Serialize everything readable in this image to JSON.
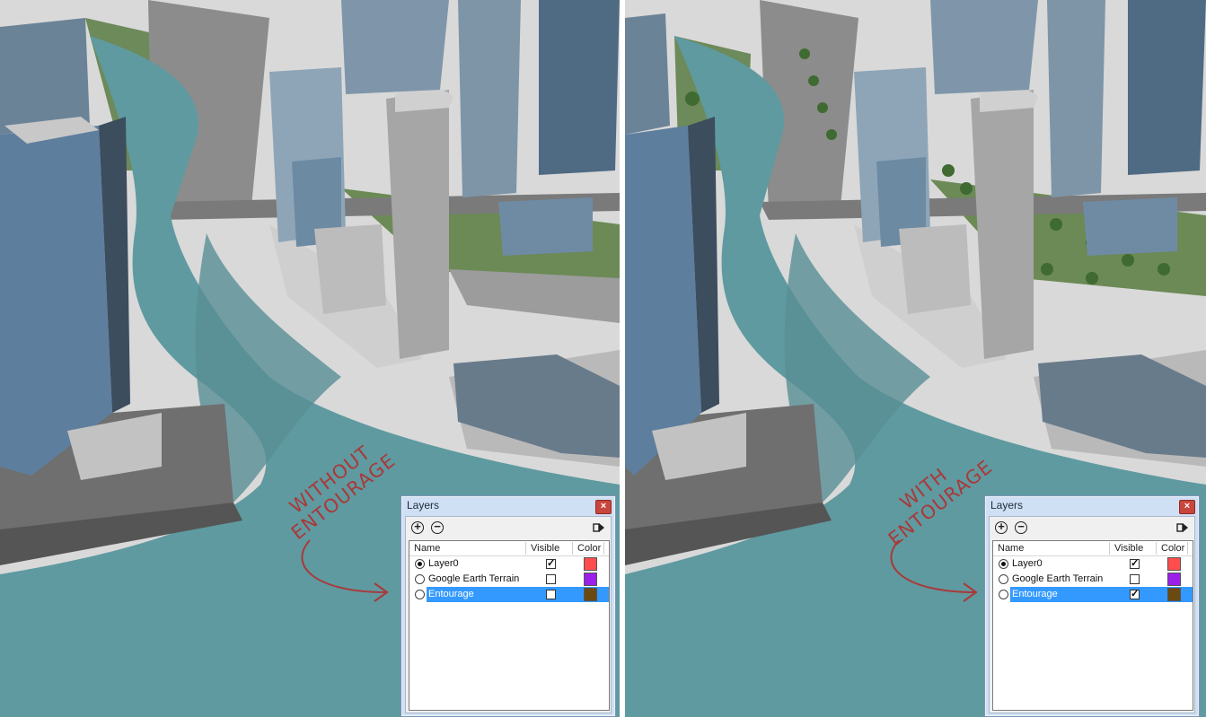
{
  "colors": {
    "water": "#5f9aa0",
    "selection": "#3399ff",
    "annotation": "#a83a3a"
  },
  "left": {
    "annotation": [
      "WITHOUT",
      "ENTOURAGE"
    ],
    "layers": {
      "title": "Layers",
      "close_label": "×",
      "columns": {
        "name": "Name",
        "visible": "Visible",
        "color": "Color"
      },
      "toolbar": {
        "add_icon": "add-layer-icon",
        "remove_icon": "remove-layer-icon",
        "details_icon": "details-arrow-icon"
      },
      "rows": [
        {
          "name": "Layer0",
          "active": true,
          "visible": true,
          "color": "#ff4d4d",
          "selected": false
        },
        {
          "name": "Google Earth Terrain",
          "active": false,
          "visible": false,
          "color": "#9b1fe8",
          "selected": false
        },
        {
          "name": "Entourage",
          "active": false,
          "visible": false,
          "color": "#6b4a12",
          "selected": true
        }
      ]
    }
  },
  "right": {
    "annotation": [
      "WITH",
      "ENTOURAGE"
    ],
    "layers": {
      "title": "Layers",
      "close_label": "×",
      "columns": {
        "name": "Name",
        "visible": "Visible",
        "color": "Color"
      },
      "toolbar": {
        "add_icon": "add-layer-icon",
        "remove_icon": "remove-layer-icon",
        "details_icon": "details-arrow-icon"
      },
      "rows": [
        {
          "name": "Layer0",
          "active": true,
          "visible": true,
          "color": "#ff4d4d",
          "selected": false
        },
        {
          "name": "Google Earth Terrain",
          "active": false,
          "visible": false,
          "color": "#9b1fe8",
          "selected": false
        },
        {
          "name": "Entourage",
          "active": false,
          "visible": true,
          "color": "#6b4a12",
          "selected": true
        }
      ]
    }
  }
}
